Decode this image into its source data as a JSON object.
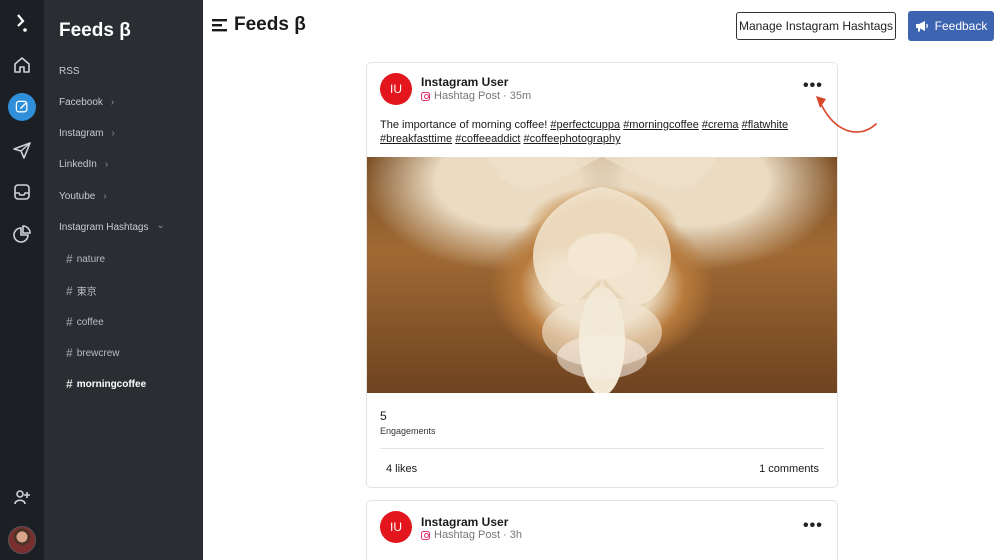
{
  "sidebar": {
    "title": "Feeds β",
    "items": [
      {
        "label": "RSS",
        "chevron": ""
      },
      {
        "label": "Facebook",
        "chevron": "›"
      },
      {
        "label": "Instagram",
        "chevron": "›"
      },
      {
        "label": "LinkedIn",
        "chevron": "›"
      },
      {
        "label": "Youtube",
        "chevron": "›"
      },
      {
        "label": "Instagram Hashtags",
        "chevron": "⌄"
      }
    ],
    "hashtags": [
      {
        "label": "nature"
      },
      {
        "label": "東京"
      },
      {
        "label": "coffee"
      },
      {
        "label": "brewcrew"
      },
      {
        "label": "morningcoffee"
      }
    ]
  },
  "header": {
    "title": "Feeds β",
    "manage_label": "Manage Instagram Hashtags",
    "feedback_label": "Feedback"
  },
  "posts": [
    {
      "avatar": "IU",
      "user": "Instagram User",
      "type": "Hashtag Post",
      "time": "· 35m",
      "caption_text": "The importance of morning coffee!",
      "tags": [
        "#perfectcuppa",
        "#morningcoffee",
        "#crema",
        "#flatwhite",
        "#breakfasttime",
        "#coffeeaddict",
        "#coffeephotography"
      ],
      "engagements_count": "5",
      "engagements_label": "Engagements",
      "likes": "4 likes",
      "comments": "1 comments",
      "more": "•••"
    },
    {
      "avatar": "IU",
      "user": "Instagram User",
      "type": "Hashtag Post",
      "time": "· 3h",
      "more": "•••"
    }
  ],
  "colors": {
    "rail_bg": "#1c1f23",
    "sidebar_bg": "#2a2d32",
    "accent_blue": "#2f8fd8",
    "feedback_bg": "#3d64b0",
    "avatar_red": "#e2161c",
    "arrow_red": "#d9472b"
  }
}
